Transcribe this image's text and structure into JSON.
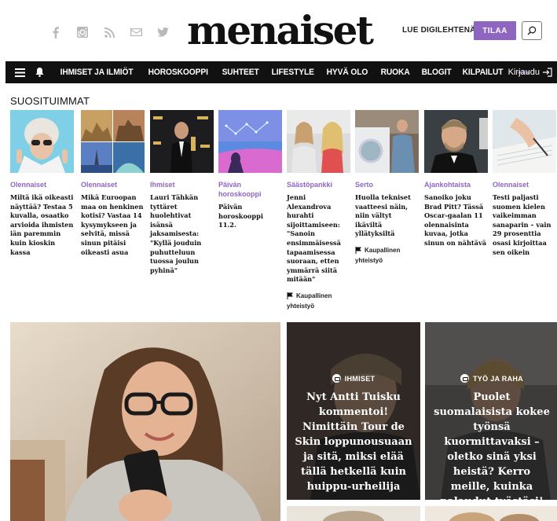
{
  "header": {
    "logo": "menaiset",
    "social_icons": [
      "facebook-icon",
      "instagram-icon",
      "rss-icon",
      "mail-icon",
      "twitter-icon"
    ],
    "read_digital": "LUE DIGILEHTENÄ",
    "order": "TILAA"
  },
  "nav": {
    "items": [
      "IHMISET JA ILMIÖT",
      "HOROSKOOPPI",
      "SUHTEET",
      "LIFESTYLE",
      "HYVÄ OLO",
      "RUOKA",
      "BLOGIT",
      "KILPAILUT"
    ],
    "more": "•••",
    "login": "Kirjaudu"
  },
  "popular": {
    "heading": "SUOSITUIMMAT",
    "cards": [
      {
        "category": "Olennaiset",
        "title": "Miltä ikä oikeasti näyttää? Testaa 5 kuvalla, osaatko arvioida ihmisten iän paremmin kuin kioskin kassa"
      },
      {
        "category": "Olennaiset",
        "title": "Mikä Euroopan maa on henkinen kotisi? Vastaa 14 kysymykseen ja selvitä, missä sinun pitäisi oikeasti asua"
      },
      {
        "category": "Ihmiset",
        "title": "Lauri Tähkän tyttäret huolehtivat isänsä jaksamisesta: \"Kyllä jouduin puhutteluun tuossa joulun pyhinä\""
      },
      {
        "category": "Päivän horoskooppi",
        "title": "Päivän horoskooppi 11.2."
      },
      {
        "category": "Säästöpankki",
        "title": "Jenni Alexandrova hurahti sijoittamiseen: \"Sanoin ensimmäisessä tapaamisessa suoraan, etten ymmärrä siitä mitään\"",
        "sponsor": "Kaupallinen",
        "sponsor2": "yhteistyö"
      },
      {
        "category": "Serto",
        "title": "Huolla tekniset vaatteesi näin, niin vältyt ikäviltä yllätyksiltä",
        "sponsor": "Kaupallinen",
        "sponsor2": "yhteistyö"
      },
      {
        "category": "Ajankohtaista",
        "title": "Sanoiko joku Brad Pitt? Tässä Oscar-gaalan 11 olennaisinta kuvaa, jotka sinun on nähtävä"
      },
      {
        "category": "Olennaiset",
        "title": "Testi paljasti suomen kielen vaikeimman sanaparin – vain 29 prosenttia osasi kirjoittaa sen oikein"
      }
    ]
  },
  "hero": {
    "cards": [
      {
        "tag": "IHMISET",
        "title": "Nyt Antti Tuisku kommentoi! Nimittäin Tour de Skin loppunousuaan ja sitä, miksi elää tällä hetkellä kuin huippu-urheilija"
      },
      {
        "tag": "TYÖ JA RAHA",
        "title": "Puolet suomalaisista kokee työnsä kuormittavaksi – oletko sinä yksi heistä? Kerro meille, kuinka palaudut työstäsi!"
      }
    ]
  },
  "colors": {
    "accent": "#8e66c2",
    "nav_bg": "#111111",
    "social_grey": "#b9b9b9"
  }
}
